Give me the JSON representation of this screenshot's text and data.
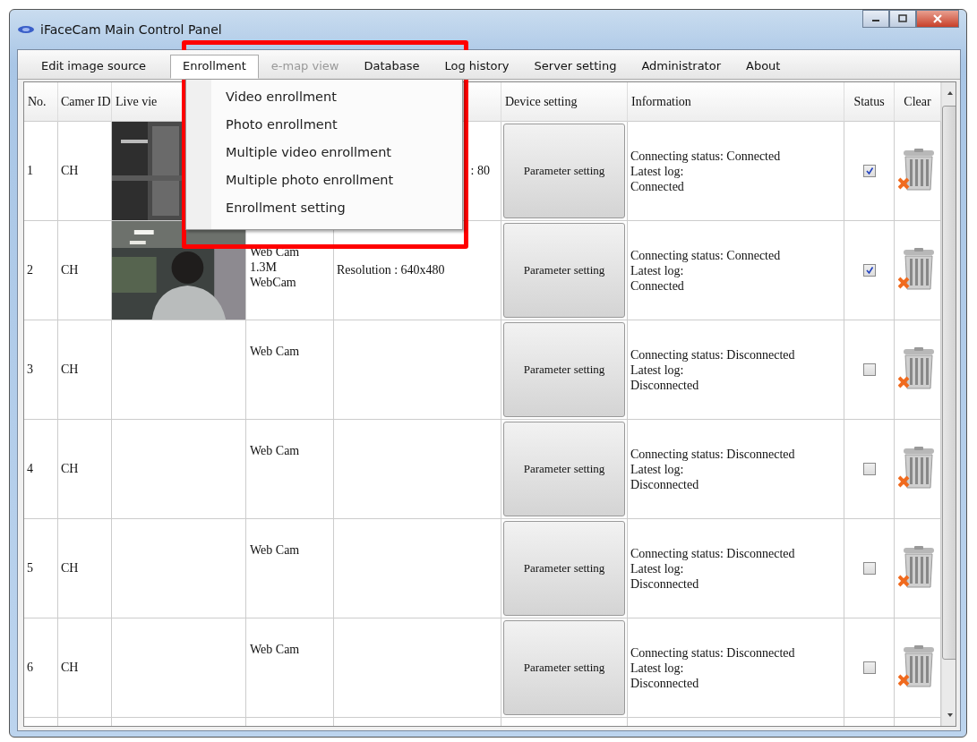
{
  "window": {
    "title": "iFaceCam Main Control Panel"
  },
  "menu": [
    {
      "label": "Edit image source",
      "selected": false,
      "disabled": false
    },
    {
      "label": "Enrollment",
      "selected": true,
      "disabled": false
    },
    {
      "label": "e-map view",
      "selected": false,
      "disabled": true
    },
    {
      "label": "Database",
      "selected": false,
      "disabled": false
    },
    {
      "label": "Log history",
      "selected": false,
      "disabled": false
    },
    {
      "label": "Server setting",
      "selected": false,
      "disabled": false
    },
    {
      "label": "Administrator",
      "selected": false,
      "disabled": false
    },
    {
      "label": "About",
      "selected": false,
      "disabled": false
    }
  ],
  "dropdown": {
    "items": [
      "Video enrollment",
      "Photo enrollment",
      "Multiple video enrollment",
      "Multiple photo enrollment",
      "Enrollment setting"
    ]
  },
  "table": {
    "columns": [
      "No.",
      "Camer ID",
      "Live vie",
      "Device setting",
      "Information",
      "Status",
      "Clear"
    ],
    "rows": [
      {
        "no": "1",
        "camera_id": "CH",
        "resolution": ": 80",
        "resolution_cut": true,
        "button": "Parameter setting",
        "info": [
          "Connecting status: Connected",
          "Latest log:",
          "Connected"
        ],
        "checked": true
      },
      {
        "no": "2",
        "camera_id": "CH",
        "type_lines": [
          "Web Cam",
          "1.3M",
          "WebCam"
        ],
        "resolution": "Resolution : 640x480",
        "button": "Parameter setting",
        "info": [
          "Connecting status: Connected",
          "Latest log:",
          "Connected"
        ],
        "checked": true
      },
      {
        "no": "3",
        "camera_id": "CH",
        "type_lines": [
          "Web Cam"
        ],
        "button": "Parameter setting",
        "info": [
          "Connecting status: Disconnected",
          "Latest log:",
          "Disconnected"
        ],
        "checked": false
      },
      {
        "no": "4",
        "camera_id": "CH",
        "type_lines": [
          "Web Cam"
        ],
        "button": "Parameter setting",
        "info": [
          "Connecting status: Disconnected",
          "Latest log:",
          "Disconnected"
        ],
        "checked": false
      },
      {
        "no": "5",
        "camera_id": "CH",
        "type_lines": [
          "Web Cam"
        ],
        "button": "Parameter setting",
        "info": [
          "Connecting status: Disconnected",
          "Latest log:",
          "Disconnected"
        ],
        "checked": false
      },
      {
        "no": "6",
        "camera_id": "CH",
        "type_lines": [
          "Web Cam"
        ],
        "button": "Parameter setting",
        "info": [
          "Connecting status: Disconnected",
          "Latest log:",
          "Disconnected"
        ],
        "checked": false
      }
    ]
  },
  "annotation": {
    "kind": "highlight"
  }
}
